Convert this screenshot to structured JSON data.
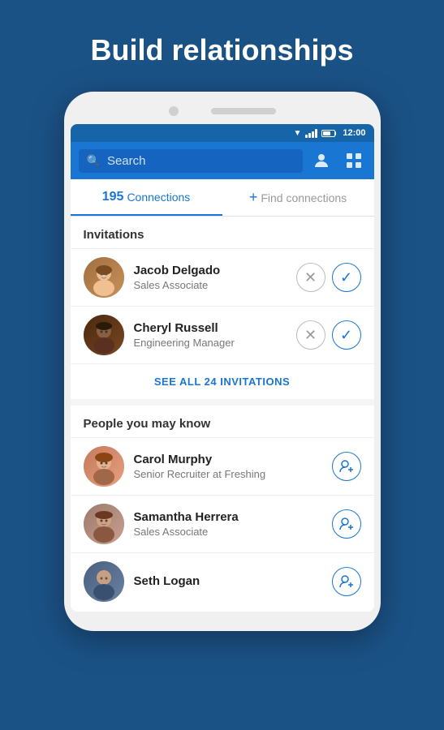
{
  "page": {
    "headline": "Build relationships",
    "background_color": "#1b5286"
  },
  "status_bar": {
    "time": "12:00"
  },
  "search": {
    "placeholder": "Search"
  },
  "tabs": {
    "connections_count": "195",
    "connections_label": "Connections",
    "find_connections_label": "Find connections"
  },
  "invitations": {
    "section_label": "Invitations",
    "see_all_label": "SEE ALL 24 INVITATIONS",
    "people": [
      {
        "name": "Jacob Delgado",
        "title": "Sales Associate",
        "avatar_color_from": "#a0714a",
        "avatar_color_to": "#c49060"
      },
      {
        "name": "Cheryl Russell",
        "title": "Engineering Manager",
        "avatar_color_from": "#5a3825",
        "avatar_color_to": "#7a5835"
      }
    ]
  },
  "people_you_may_know": {
    "section_label": "People you may know",
    "people": [
      {
        "name": "Carol Murphy",
        "title": "Senior Recruiter at Freshing",
        "avatar_color_from": "#c47a5a",
        "avatar_color_to": "#e8a080"
      },
      {
        "name": "Samantha Herrera",
        "title": "Sales Associate",
        "avatar_color_from": "#9b7a6b",
        "avatar_color_to": "#c9a090"
      },
      {
        "name": "Seth Logan",
        "title": "",
        "avatar_color_from": "#4a6080",
        "avatar_color_to": "#6a80a0"
      }
    ]
  }
}
